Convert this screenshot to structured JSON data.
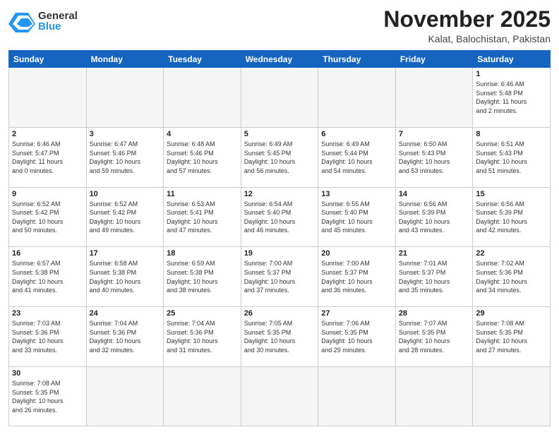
{
  "header": {
    "logo_general": "General",
    "logo_blue": "Blue",
    "month_title": "November 2025",
    "location": "Kalat, Balochistan, Pakistan"
  },
  "weekdays": [
    "Sunday",
    "Monday",
    "Tuesday",
    "Wednesday",
    "Thursday",
    "Friday",
    "Saturday"
  ],
  "weeks": [
    [
      {
        "num": "",
        "info": ""
      },
      {
        "num": "",
        "info": ""
      },
      {
        "num": "",
        "info": ""
      },
      {
        "num": "",
        "info": ""
      },
      {
        "num": "",
        "info": ""
      },
      {
        "num": "",
        "info": ""
      },
      {
        "num": "1",
        "info": "Sunrise: 6:46 AM\nSunset: 5:48 PM\nDaylight: 11 hours\nand 2 minutes."
      }
    ],
    [
      {
        "num": "2",
        "info": "Sunrise: 6:46 AM\nSunset: 5:47 PM\nDaylight: 11 hours\nand 0 minutes."
      },
      {
        "num": "3",
        "info": "Sunrise: 6:47 AM\nSunset: 5:46 PM\nDaylight: 10 hours\nand 59 minutes."
      },
      {
        "num": "4",
        "info": "Sunrise: 6:48 AM\nSunset: 5:46 PM\nDaylight: 10 hours\nand 57 minutes."
      },
      {
        "num": "5",
        "info": "Sunrise: 6:49 AM\nSunset: 5:45 PM\nDaylight: 10 hours\nand 56 minutes."
      },
      {
        "num": "6",
        "info": "Sunrise: 6:49 AM\nSunset: 5:44 PM\nDaylight: 10 hours\nand 54 minutes."
      },
      {
        "num": "7",
        "info": "Sunrise: 6:50 AM\nSunset: 5:43 PM\nDaylight: 10 hours\nand 53 minutes."
      },
      {
        "num": "8",
        "info": "Sunrise: 6:51 AM\nSunset: 5:43 PM\nDaylight: 10 hours\nand 51 minutes."
      }
    ],
    [
      {
        "num": "9",
        "info": "Sunrise: 6:52 AM\nSunset: 5:42 PM\nDaylight: 10 hours\nand 50 minutes."
      },
      {
        "num": "10",
        "info": "Sunrise: 6:52 AM\nSunset: 5:42 PM\nDaylight: 10 hours\nand 49 minutes."
      },
      {
        "num": "11",
        "info": "Sunrise: 6:53 AM\nSunset: 5:41 PM\nDaylight: 10 hours\nand 47 minutes."
      },
      {
        "num": "12",
        "info": "Sunrise: 6:54 AM\nSunset: 5:40 PM\nDaylight: 10 hours\nand 46 minutes."
      },
      {
        "num": "13",
        "info": "Sunrise: 6:55 AM\nSunset: 5:40 PM\nDaylight: 10 hours\nand 45 minutes."
      },
      {
        "num": "14",
        "info": "Sunrise: 6:56 AM\nSunset: 5:39 PM\nDaylight: 10 hours\nand 43 minutes."
      },
      {
        "num": "15",
        "info": "Sunrise: 6:56 AM\nSunset: 5:39 PM\nDaylight: 10 hours\nand 42 minutes."
      }
    ],
    [
      {
        "num": "16",
        "info": "Sunrise: 6:57 AM\nSunset: 5:38 PM\nDaylight: 10 hours\nand 41 minutes."
      },
      {
        "num": "17",
        "info": "Sunrise: 6:58 AM\nSunset: 5:38 PM\nDaylight: 10 hours\nand 40 minutes."
      },
      {
        "num": "18",
        "info": "Sunrise: 6:59 AM\nSunset: 5:38 PM\nDaylight: 10 hours\nand 38 minutes."
      },
      {
        "num": "19",
        "info": "Sunrise: 7:00 AM\nSunset: 5:37 PM\nDaylight: 10 hours\nand 37 minutes."
      },
      {
        "num": "20",
        "info": "Sunrise: 7:00 AM\nSunset: 5:37 PM\nDaylight: 10 hours\nand 36 minutes."
      },
      {
        "num": "21",
        "info": "Sunrise: 7:01 AM\nSunset: 5:37 PM\nDaylight: 10 hours\nand 35 minutes."
      },
      {
        "num": "22",
        "info": "Sunrise: 7:02 AM\nSunset: 5:36 PM\nDaylight: 10 hours\nand 34 minutes."
      }
    ],
    [
      {
        "num": "23",
        "info": "Sunrise: 7:03 AM\nSunset: 5:36 PM\nDaylight: 10 hours\nand 33 minutes."
      },
      {
        "num": "24",
        "info": "Sunrise: 7:04 AM\nSunset: 5:36 PM\nDaylight: 10 hours\nand 32 minutes."
      },
      {
        "num": "25",
        "info": "Sunrise: 7:04 AM\nSunset: 5:36 PM\nDaylight: 10 hours\nand 31 minutes."
      },
      {
        "num": "26",
        "info": "Sunrise: 7:05 AM\nSunset: 5:35 PM\nDaylight: 10 hours\nand 30 minutes."
      },
      {
        "num": "27",
        "info": "Sunrise: 7:06 AM\nSunset: 5:35 PM\nDaylight: 10 hours\nand 29 minutes."
      },
      {
        "num": "28",
        "info": "Sunrise: 7:07 AM\nSunset: 5:35 PM\nDaylight: 10 hours\nand 28 minutes."
      },
      {
        "num": "29",
        "info": "Sunrise: 7:08 AM\nSunset: 5:35 PM\nDaylight: 10 hours\nand 27 minutes."
      }
    ],
    [
      {
        "num": "30",
        "info": "Sunrise: 7:08 AM\nSunset: 5:35 PM\nDaylight: 10 hours\nand 26 minutes."
      },
      {
        "num": "",
        "info": ""
      },
      {
        "num": "",
        "info": ""
      },
      {
        "num": "",
        "info": ""
      },
      {
        "num": "",
        "info": ""
      },
      {
        "num": "",
        "info": ""
      },
      {
        "num": "",
        "info": ""
      }
    ]
  ]
}
